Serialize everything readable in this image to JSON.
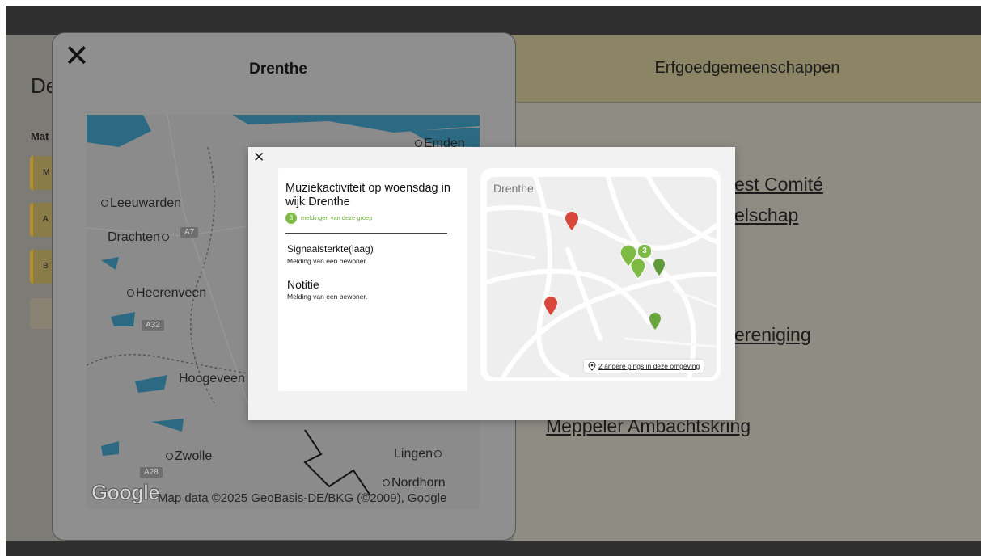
{
  "base": {
    "heading": "De",
    "subheading": "Mat",
    "buttons": [
      "M",
      "A",
      "B"
    ]
  },
  "right_panel": {
    "title": "Erfgoedgemeenschappen",
    "orgs": [
      "est Comité",
      "elschap",
      "ereniging",
      "Meppeler Ambachtskring"
    ]
  },
  "province_panel": {
    "title": "Drenthe",
    "map": {
      "cities": [
        "Emden",
        "Leeuwarden",
        "Drachten",
        "Heerenveen",
        "Hoogeveen",
        "Zwolle",
        "Lingen",
        "Nordhorn"
      ],
      "roads": [
        "A7",
        "A32",
        "A28"
      ],
      "logo": "Google",
      "attribution": "Map data ©2025 GeoBasis-DE/BKG (©2009), Google"
    }
  },
  "modal": {
    "title": "Muziekactiviteit op woensdag in wijk Drenthe",
    "group_count": "3",
    "group_text": "meldingen van deze groep",
    "signal_title": "Signaalsterkte(laag)",
    "signal_sub": "Melding van een bewoner",
    "note_title": "Notitie",
    "note_sub": "Melding van een bewoner.",
    "mini_map_label": "Drenthe",
    "cluster_count": "3",
    "pings_text": "2 andere pings in deze omgeving",
    "colors": {
      "green": "#7dbb45",
      "dark_green": "#5e9a3a",
      "red": "#d9463b"
    }
  }
}
